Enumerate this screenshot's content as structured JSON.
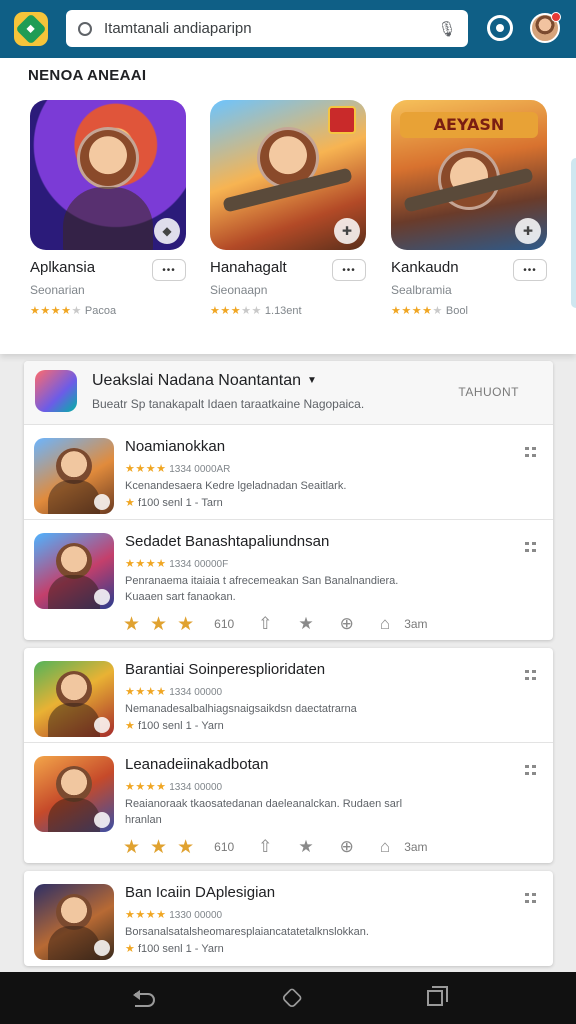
{
  "search": {
    "value": "Itamtanali andiaparipn"
  },
  "carousel": {
    "title": "NENOA ANEAAI",
    "games": [
      {
        "name": "Aplkansia",
        "dev": "Seonarian",
        "more": "•••",
        "rating_text": "Pacoa",
        "stars": 4
      },
      {
        "name": "Hanahagalt",
        "dev": "Sieonaapn",
        "more": "•••",
        "rating_text": "1.13ent",
        "stars": 3
      },
      {
        "name": "Kankaudn",
        "dev": "Sealbramia",
        "more": "•••",
        "rating_text": "Bool",
        "stars": 4,
        "sign": "AEYASN"
      }
    ]
  },
  "section": {
    "title": "Ueakslai Nadana Noantantan",
    "subtitle": "Bueatr Sp tanakapalt Idaen taraatkaine Nagopaica.",
    "action": "TAHUONT"
  },
  "items": [
    {
      "title": "Noamianokkan",
      "meta": "1334 0000AR",
      "desc": "Kcenandesaera Kedre lgeladnadan Seaitlark.",
      "info": "f100 senl 1 - Tarn"
    },
    {
      "title": "Sedadet Banashtapaliundnsan",
      "meta": "1334 00000F",
      "desc": "Penranaema itaiaia t afrecemeakan San Banalnandiera. Kuaaen sart fanaokan.",
      "info": "",
      "actions": {
        "count": "610",
        "label": "3am"
      }
    },
    {
      "title": "Barantiai Soinperesplioridaten",
      "meta": "1334 00000",
      "desc": "Nemanadesalbalhiagsnaigsaikdsn daectatrarna",
      "info": "f100 senl 1 - Yarn"
    },
    {
      "title": "Leanadeiinakadbotan",
      "meta": "1334 00000",
      "desc": "Reaianoraak tkaosatedanan daeleanalckan. Rudaen sarl hranlan",
      "info": "",
      "actions": {
        "count": "610",
        "label": "3am"
      }
    },
    {
      "title": "Ban Icaiin DAplesigian",
      "meta": "1330 00000",
      "desc": "Borsanalsatalsheomaresplaiancatatetalknslokkan.",
      "info": "f100 senl 1 - Yarn"
    }
  ]
}
